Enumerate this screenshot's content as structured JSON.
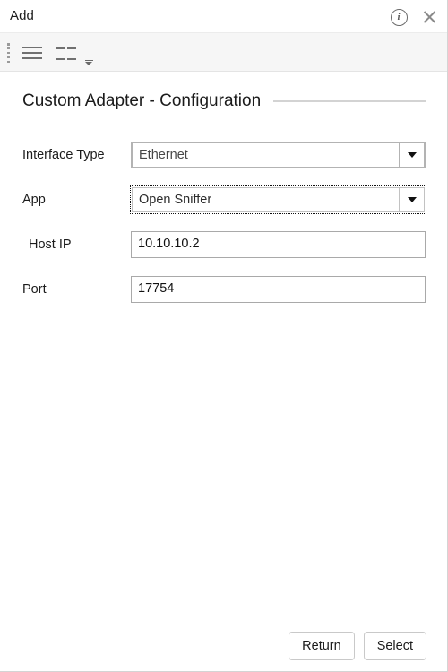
{
  "window": {
    "title": "Add"
  },
  "titlebar": {
    "info_icon": "info-icon",
    "info_glyph": "i",
    "close_icon": "close-icon"
  },
  "toolbar": {
    "drag_handle": "drag-handle",
    "items": [
      {
        "name": "list-view-icon"
      },
      {
        "name": "grid-view-icon"
      }
    ],
    "overflow": "toolbar-overflow-caret"
  },
  "section": {
    "title": "Custom Adapter - Configuration"
  },
  "form": {
    "fields": [
      {
        "label": "Interface Type",
        "type": "combo",
        "value": "Ethernet",
        "focused": false,
        "indent": false
      },
      {
        "label": "App",
        "type": "combo",
        "value": "Open Sniffer",
        "focused": true,
        "indent": false
      },
      {
        "label": "Host IP",
        "type": "text",
        "value": "10.10.10.2",
        "focused": false,
        "indent": true
      },
      {
        "label": "Port",
        "type": "text",
        "value": "17754",
        "focused": false,
        "indent": false
      }
    ]
  },
  "footer": {
    "return_label": "Return",
    "select_label": "Select"
  },
  "colors": {
    "toolbar_bg": "#f6f6f6",
    "field_border": "#a9a9a9",
    "rule": "#d3d3d3",
    "icon_gray": "#707070"
  }
}
